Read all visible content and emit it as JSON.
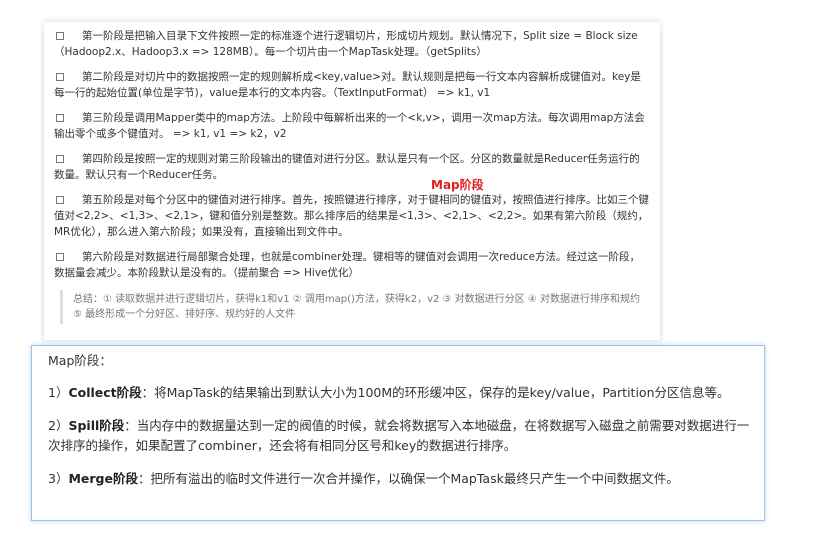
{
  "top": {
    "paragraphs": [
      "第一阶段是把输入目录下文件按照一定的标准逐个进行逻辑切片，形成切片规划。默认情况下，Split size = Block size（Hadoop2.x、Hadoop3.x => 128MB）。每一个切片由一个MapTask处理。（getSplits）",
      "第二阶段是对切片中的数据按照一定的规则解析成<key,value>对。默认规则是把每一行文本内容解析成键值对。key是每一行的起始位置(单位是字节)，value是本行的文本内容。（TextInputFormat） => k1, v1",
      "第三阶段是调用Mapper类中的map方法。上阶段中每解析出来的一个<k,v>，调用一次map方法。每次调用map方法会输出零个或多个键值对。 => k1, v1 => k2，v2",
      "第四阶段是按照一定的规则对第三阶段输出的键值对进行分区。默认是只有一个区。分区的数量就是Reducer任务运行的数量。默认只有一个Reducer任务。",
      "第五阶段是对每个分区中的键值对进行排序。首先，按照键进行排序，对于键相同的键值对，按照值进行排序。比如三个键值对<2,2>、<1,3>、<2,1>，键和值分别是整数。那么排序后的结果是<1,3>、<2,1>、<2,2>。如果有第六阶段（规约，MR优化），那么进入第六阶段；如果没有，直接输出到文件中。",
      "第六阶段是对数据进行局部聚合处理，也就是combiner处理。键相等的键值对会调用一次reduce方法。经过这一阶段，数据量会减少。本阶段默认是没有的。（提前聚合 => Hive优化）"
    ],
    "map_stage_label": "Map阶段",
    "summary": "总结：① 读取数据并进行逻辑切片，获得k1和v1 ② 调用map()方法，获得k2，v2 ③ 对数据进行分区 ④ 对数据进行排序和规约 ⑤ 最终形成一个分好区、排好序、规约好的人文件"
  },
  "bottom": {
    "title": "Map阶段：",
    "items": [
      {
        "prefix": "1）",
        "term": "Collect阶段",
        "text": "：将MapTask的结果输出到默认大小为100M的环形缓冲区，保存的是key/value，Partition分区信息等。"
      },
      {
        "prefix": "2）",
        "term": "Spill阶段",
        "text": "：当内存中的数据量达到一定的阀值的时候，就会将数据写入本地磁盘，在将数据写入磁盘之前需要对数据进行一次排序的操作，如果配置了combiner，还会将有相同分区号和key的数据进行排序。"
      },
      {
        "prefix": "3）",
        "term": "Merge阶段",
        "text": "：把所有溢出的临时文件进行一次合并操作，以确保一个MapTask最终只产生一个中间数据文件。"
      }
    ]
  }
}
